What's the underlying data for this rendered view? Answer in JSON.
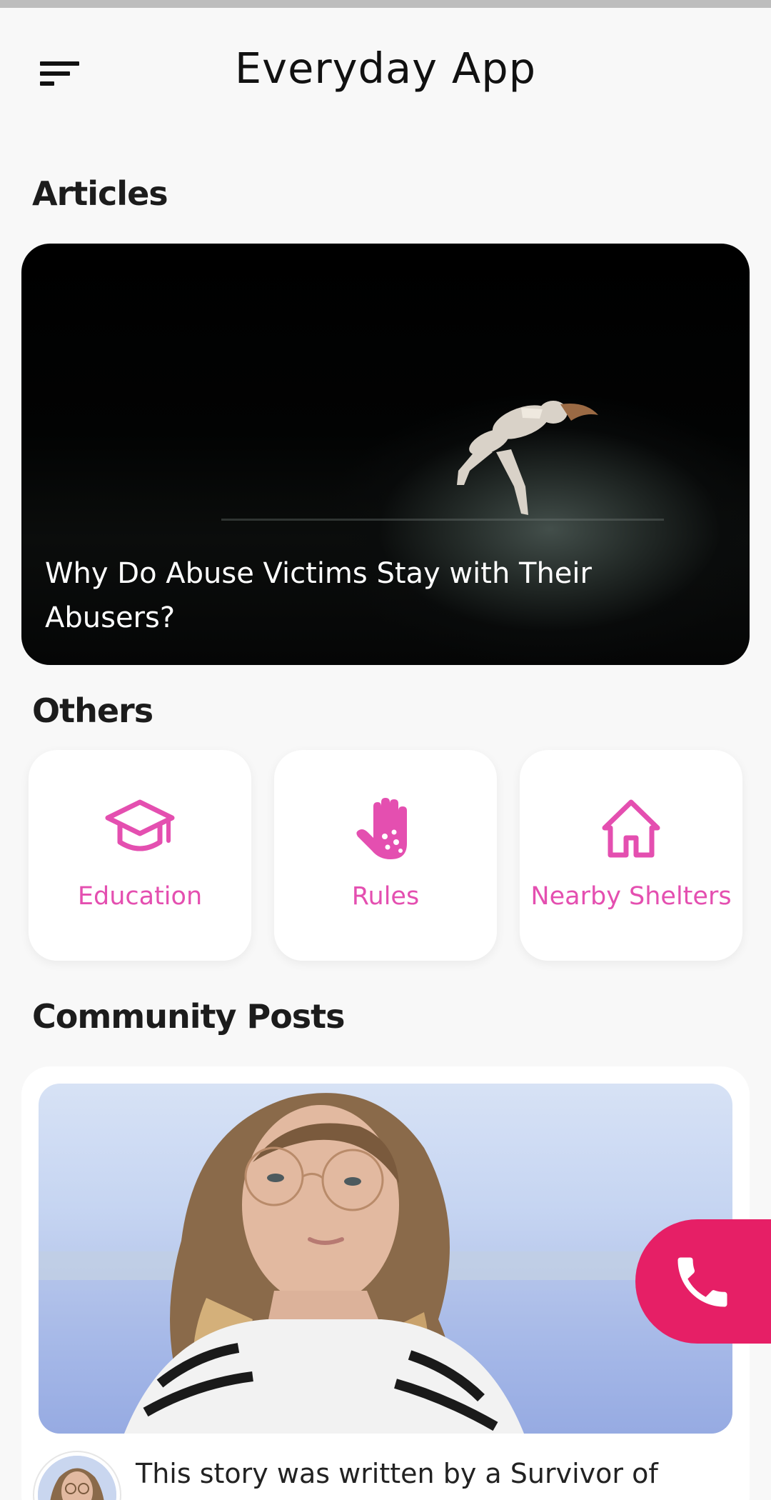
{
  "app": {
    "title": "Everyday App"
  },
  "sections": {
    "articles": "Articles",
    "others": "Others",
    "community": "Community Posts"
  },
  "article": {
    "title": "Why Do Abuse Victims Stay with Their Abusers?"
  },
  "others": [
    {
      "label": "Education",
      "icon": "graduation-cap-icon"
    },
    {
      "label": "Rules",
      "icon": "hand-icon"
    },
    {
      "label": "Nearby Shelters",
      "icon": "house-icon"
    }
  ],
  "post": {
    "snippet": "This story was written by a Survivor of"
  },
  "colors": {
    "accent": "#e44fb0",
    "call": "#e61f66",
    "background": "#f8f8f8"
  }
}
